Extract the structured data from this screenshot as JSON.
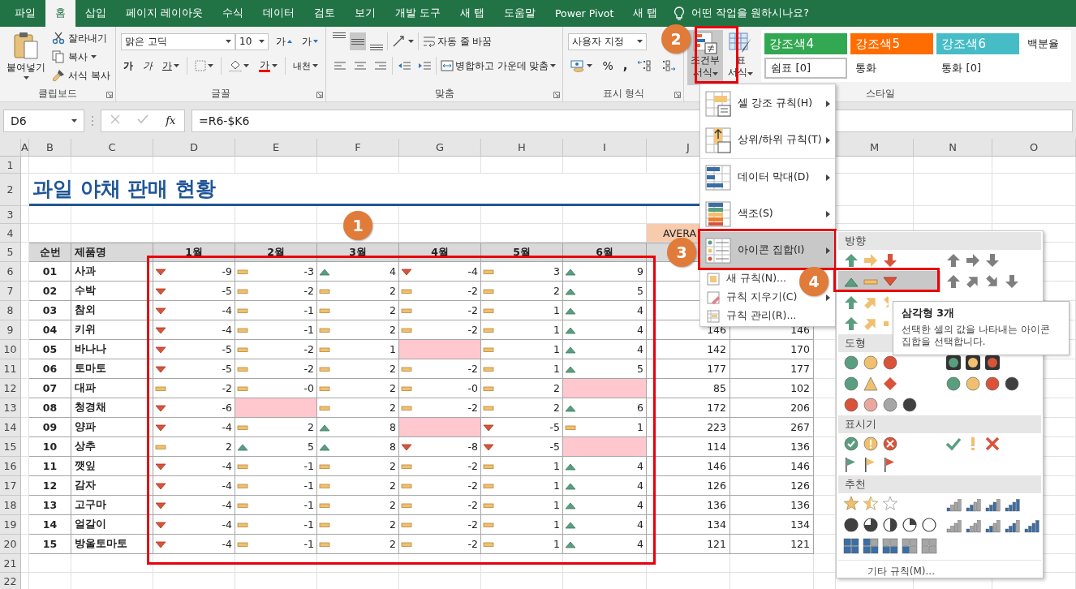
{
  "tabs": [
    {
      "label": "파일",
      "selected": false
    },
    {
      "label": "홈",
      "selected": true
    },
    {
      "label": "삽입",
      "selected": false
    },
    {
      "label": "페이지 레이아웃",
      "selected": false
    },
    {
      "label": "수식",
      "selected": false
    },
    {
      "label": "데이터",
      "selected": false
    },
    {
      "label": "검토",
      "selected": false
    },
    {
      "label": "보기",
      "selected": false
    },
    {
      "label": "개발 도구",
      "selected": false
    },
    {
      "label": "새 탭",
      "selected": false
    },
    {
      "label": "도움말",
      "selected": false
    },
    {
      "label": "Power Pivot",
      "selected": false
    },
    {
      "label": "새 탭",
      "selected": false
    }
  ],
  "tell_me": "어떤 작업을 원하시나요?",
  "ribbon": {
    "clipboard": {
      "title": "클립보드",
      "paste": "붙여넣기",
      "cut": "잘라내기",
      "copy": "복사",
      "format_painter": "서식 복사"
    },
    "font": {
      "title": "글꼴",
      "name": "맑은 고딕",
      "size": "10",
      "buttons": [
        {
          "kind": "grow",
          "label": "가"
        },
        {
          "kind": "shrink",
          "label": "가"
        },
        {
          "kind": "bold",
          "label": "가"
        },
        {
          "kind": "italic",
          "label": "가"
        },
        {
          "kind": "underline",
          "label": "가"
        },
        {
          "kind": "font_color",
          "label": "가"
        },
        {
          "kind": "phonetic",
          "label": "내천"
        }
      ]
    },
    "alignment": {
      "title": "맞춤",
      "vertical": [
        {
          "kind": "top",
          "selected": false
        },
        {
          "kind": "middle",
          "selected": true
        },
        {
          "kind": "bottom",
          "selected": false
        }
      ],
      "wrap_text": "자동 줄 바꿈",
      "merge_center": "병합하고 가운데 맞춤"
    },
    "number": {
      "title": "표시 형식",
      "format": "사용자 지정",
      "percent": "%",
      "comma": ","
    },
    "styles": {
      "title": "스타일",
      "conditional": {
        "lines": [
          "조건부",
          "서식"
        ],
        "pressed": true
      },
      "format_table": [
        "표",
        "서식"
      ],
      "gallery": [
        {
          "label": "강조색4",
          "color": "#33a852",
          "selected": false
        },
        {
          "label": "강조색5",
          "color": "#ff6d01",
          "selected": false
        },
        {
          "label": "강조색6",
          "color": "#46bdc6",
          "selected": false
        },
        {
          "label": "백분율",
          "selected": false
        },
        {
          "label": "쉼표 [0]",
          "selected": true
        },
        {
          "label": "통화",
          "selected": false
        },
        {
          "label": "통화 [0]",
          "selected": false
        }
      ]
    }
  },
  "formula_bar": {
    "name_box": "D6",
    "function_label": "fx",
    "formula": "=R6-$K6"
  },
  "sheet": {
    "column_headers": [
      "A",
      "B",
      "C",
      "D",
      "E",
      "F",
      "G",
      "H",
      "I",
      "J",
      "M",
      "N",
      "O"
    ],
    "row_headers": [
      "1",
      "2",
      "3",
      "4",
      "5",
      "6",
      "7",
      "8",
      "9",
      "10",
      "11",
      "12",
      "13",
      "14",
      "15",
      "16",
      "17",
      "18",
      "19",
      "20",
      "21",
      "22"
    ],
    "title": "과일 야채 판매 현황",
    "average_label": "AVERA",
    "columns": [
      "순번",
      "제품명",
      "1월",
      "2월",
      "3월",
      "4월",
      "5월",
      "6월"
    ],
    "rows": [
      {
        "no": "01",
        "name": "사과",
        "months": [
          {
            "kind": "down",
            "value": "-9"
          },
          {
            "kind": "flat",
            "value": "-3"
          },
          {
            "kind": "up",
            "value": "4"
          },
          {
            "kind": "down",
            "value": "-4"
          },
          {
            "kind": "flat",
            "value": "3"
          },
          {
            "kind": "up",
            "value": "9"
          }
        ]
      },
      {
        "no": "02",
        "name": "수박",
        "months": [
          {
            "kind": "down",
            "value": "-5"
          },
          {
            "kind": "flat",
            "value": "-2"
          },
          {
            "kind": "flat",
            "value": "2"
          },
          {
            "kind": "flat",
            "value": "-2"
          },
          {
            "kind": "flat",
            "value": "2"
          },
          {
            "kind": "up",
            "value": "5"
          }
        ]
      },
      {
        "no": "03",
        "name": "참외",
        "months": [
          {
            "kind": "down",
            "value": "-4"
          },
          {
            "kind": "flat",
            "value": "-1"
          },
          {
            "kind": "flat",
            "value": "2"
          },
          {
            "kind": "flat",
            "value": "-2"
          },
          {
            "kind": "flat",
            "value": "1"
          },
          {
            "kind": "up",
            "value": "4"
          }
        ]
      },
      {
        "no": "04",
        "name": "키위",
        "months": [
          {
            "kind": "down",
            "value": "-4"
          },
          {
            "kind": "flat",
            "value": "-1"
          },
          {
            "kind": "flat",
            "value": "2"
          },
          {
            "kind": "flat",
            "value": "-2"
          },
          {
            "kind": "flat",
            "value": "1"
          },
          {
            "kind": "up",
            "value": "4"
          }
        ],
        "column_j": "146",
        "column_k": "146"
      },
      {
        "no": "05",
        "name": "바나나",
        "months": [
          {
            "kind": "down",
            "value": "-5"
          },
          {
            "kind": "flat",
            "value": "-2"
          },
          {
            "kind": "flat",
            "value": "1"
          },
          {
            "kind": "highlight"
          },
          {
            "kind": "flat",
            "value": "1"
          },
          {
            "kind": "up",
            "value": "4"
          }
        ],
        "column_j": "142",
        "column_k": "170"
      },
      {
        "no": "06",
        "name": "토마토",
        "months": [
          {
            "kind": "down",
            "value": "-5"
          },
          {
            "kind": "flat",
            "value": "-2"
          },
          {
            "kind": "flat",
            "value": "2"
          },
          {
            "kind": "flat",
            "value": "-2"
          },
          {
            "kind": "flat",
            "value": "1"
          },
          {
            "kind": "up",
            "value": "5"
          }
        ],
        "column_j": "177",
        "column_k": "177"
      },
      {
        "no": "07",
        "name": "대파",
        "months": [
          {
            "kind": "flat",
            "value": "-2"
          },
          {
            "kind": "flat",
            "value": "-0"
          },
          {
            "kind": "flat",
            "value": "2"
          },
          {
            "kind": "flat",
            "value": "-0"
          },
          {
            "kind": "flat",
            "value": "2"
          },
          {
            "kind": "highlight"
          }
        ],
        "column_j": "85",
        "column_k": "102"
      },
      {
        "no": "08",
        "name": "청경채",
        "months": [
          {
            "kind": "down",
            "value": "-6"
          },
          {
            "kind": "highlight"
          },
          {
            "kind": "flat",
            "value": "2"
          },
          {
            "kind": "flat",
            "value": "-2"
          },
          {
            "kind": "flat",
            "value": "2"
          },
          {
            "kind": "up",
            "value": "6"
          }
        ],
        "column_j": "172",
        "column_k": "206"
      },
      {
        "no": "09",
        "name": "양파",
        "months": [
          {
            "kind": "down",
            "value": "-4"
          },
          {
            "kind": "flat",
            "value": "2"
          },
          {
            "kind": "up",
            "value": "8"
          },
          {
            "kind": "highlight"
          },
          {
            "kind": "down",
            "value": "-5"
          },
          {
            "kind": "flat",
            "value": "1"
          }
        ],
        "column_j": "223",
        "column_k": "267"
      },
      {
        "no": "10",
        "name": "상추",
        "months": [
          {
            "kind": "flat",
            "value": "2"
          },
          {
            "kind": "up",
            "value": "5"
          },
          {
            "kind": "up",
            "value": "8"
          },
          {
            "kind": "down",
            "value": "-8"
          },
          {
            "kind": "down",
            "value": "-5"
          },
          {
            "kind": "highlight"
          }
        ],
        "column_j": "114",
        "column_k": "136"
      },
      {
        "no": "11",
        "name": "깻잎",
        "months": [
          {
            "kind": "down",
            "value": "-4"
          },
          {
            "kind": "flat",
            "value": "-1"
          },
          {
            "kind": "flat",
            "value": "2"
          },
          {
            "kind": "flat",
            "value": "-2"
          },
          {
            "kind": "flat",
            "value": "1"
          },
          {
            "kind": "up",
            "value": "4"
          }
        ],
        "column_j": "146",
        "column_k": "146"
      },
      {
        "no": "12",
        "name": "감자",
        "months": [
          {
            "kind": "down",
            "value": "-4"
          },
          {
            "kind": "flat",
            "value": "-1"
          },
          {
            "kind": "flat",
            "value": "2"
          },
          {
            "kind": "flat",
            "value": "-2"
          },
          {
            "kind": "flat",
            "value": "1"
          },
          {
            "kind": "up",
            "value": "4"
          }
        ],
        "column_j": "126",
        "column_k": "126"
      },
      {
        "no": "13",
        "name": "고구마",
        "months": [
          {
            "kind": "down",
            "value": "-4"
          },
          {
            "kind": "flat",
            "value": "-1"
          },
          {
            "kind": "flat",
            "value": "2"
          },
          {
            "kind": "flat",
            "value": "-2"
          },
          {
            "kind": "flat",
            "value": "1"
          },
          {
            "kind": "up",
            "value": "4"
          }
        ],
        "column_j": "136",
        "column_k": "136"
      },
      {
        "no": "14",
        "name": "얼갈이",
        "months": [
          {
            "kind": "down",
            "value": "-4"
          },
          {
            "kind": "flat",
            "value": "-1"
          },
          {
            "kind": "flat",
            "value": "2"
          },
          {
            "kind": "flat",
            "value": "-2"
          },
          {
            "kind": "flat",
            "value": "1"
          },
          {
            "kind": "up",
            "value": "4"
          }
        ],
        "column_j": "134",
        "column_k": "134"
      },
      {
        "no": "15",
        "name": "방울토마토",
        "months": [
          {
            "kind": "down",
            "value": "-4"
          },
          {
            "kind": "flat",
            "value": "-1"
          },
          {
            "kind": "flat",
            "value": "2"
          },
          {
            "kind": "flat",
            "value": "-2"
          },
          {
            "kind": "flat",
            "value": "1"
          },
          {
            "kind": "up",
            "value": "4"
          }
        ],
        "column_j": "121",
        "column_k": "121"
      }
    ]
  },
  "conditional_menu": {
    "items": [
      {
        "kind": "highlight_rules",
        "label": "셀 강조 규칙(H)",
        "submenu": true,
        "selected": false
      },
      {
        "kind": "top_bottom",
        "label": "상위/하위 규칙(T)",
        "submenu": true,
        "selected": false
      },
      {
        "kind": "data_bars",
        "label": "데이터 막대(D)",
        "submenu": true,
        "selected": false
      },
      {
        "kind": "color_scales",
        "label": "색조(S)",
        "submenu": true,
        "selected": false
      },
      {
        "kind": "icon_sets",
        "label": "아이콘 집합(I)",
        "submenu": true,
        "selected": true
      },
      {
        "kind": "new_rule",
        "label": "새 규칙(N)...",
        "submenu": false,
        "selected": false
      },
      {
        "kind": "clear_rules",
        "label": "규칙 지우기(C)",
        "submenu": true,
        "selected": false
      },
      {
        "kind": "manage_rules",
        "label": "규칙 관리(R)...",
        "submenu": false,
        "selected": false
      }
    ]
  },
  "icon_sets_menu": {
    "sections": [
      {
        "title": "방향",
        "rows": [
          [
            {
              "kind": "arrows3",
              "selected": false
            },
            {
              "kind": "arrows3gray",
              "selected": false
            }
          ],
          [
            {
              "kind": "triangles3",
              "selected": true
            },
            {
              "kind": "arrows4gray",
              "selected": false
            }
          ],
          [
            {
              "kind": "arrows4",
              "selected": false
            }
          ],
          [
            {
              "kind": "arrows5",
              "selected": false
            }
          ]
        ]
      },
      {
        "title": "도형",
        "rows": [
          [
            {
              "kind": "circles3",
              "selected": false
            },
            {
              "kind": "traffic3",
              "selected": false
            }
          ],
          [
            {
              "kind": "signs3",
              "selected": false
            },
            {
              "kind": "traffic4",
              "selected": false
            }
          ],
          [
            {
              "kind": "redtoblack4",
              "selected": false
            }
          ]
        ]
      },
      {
        "title": "표시기",
        "rows": [
          [
            {
              "kind": "symbols3circled",
              "selected": false
            },
            {
              "kind": "symbols3",
              "selected": false
            }
          ],
          [
            {
              "kind": "flags3",
              "selected": false
            }
          ]
        ]
      },
      {
        "title": "추천",
        "rows": [
          [
            {
              "kind": "stars3",
              "selected": false
            },
            {
              "kind": "ratings4",
              "selected": false
            }
          ],
          [
            {
              "kind": "quarters5",
              "selected": false
            },
            {
              "kind": "ratings5",
              "selected": false
            }
          ],
          [
            {
              "kind": "boxes5",
              "selected": false
            }
          ]
        ]
      }
    ],
    "more_rules": "기타 규칙(M)..."
  },
  "tooltip": {
    "title": "삼각형 3개",
    "text": "선택한 셀의 값을 나타내는 아이콘 집합을 선택합니다."
  },
  "callouts": [
    "1",
    "2",
    "3",
    "4"
  ]
}
